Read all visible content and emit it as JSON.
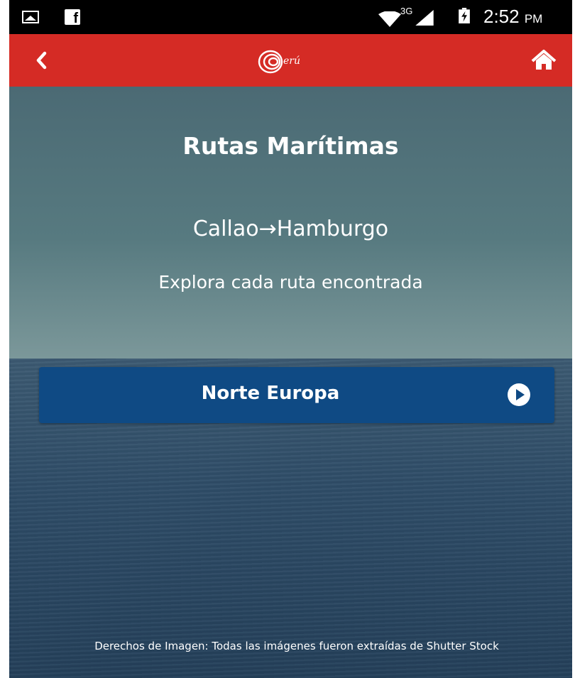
{
  "status_bar": {
    "time": "2:52",
    "ampm": "PM",
    "network": "3G",
    "icons": [
      "gallery-icon",
      "facebook-icon",
      "wifi-icon",
      "signal-icon",
      "battery-icon"
    ]
  },
  "app_bar": {
    "logo_text": "erú",
    "icons": [
      "back-icon",
      "peru-logo",
      "home-icon"
    ],
    "color": "#d52b25"
  },
  "content": {
    "title": "Rutas Marítimas",
    "route": "Callao→Hamburgo",
    "subtitle": "Explora cada ruta encontrada"
  },
  "route_button": {
    "label": "Norte Europa",
    "icon": "play-circle-icon",
    "color": "#0f4a84"
  },
  "footer": {
    "credits": "Derechos de Imagen: Todas las imágenes fueron extraídas de Shutter Stock"
  }
}
